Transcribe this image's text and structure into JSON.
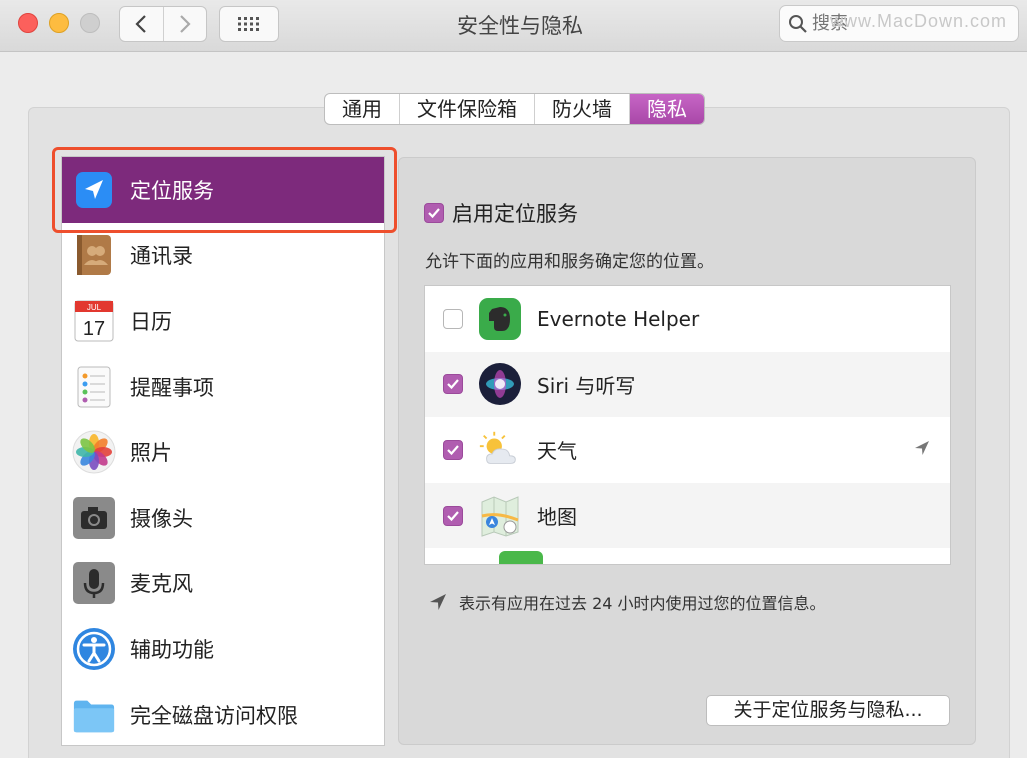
{
  "window": {
    "title": "安全性与隐私",
    "search_placeholder": "搜索",
    "watermark": "www.MacDown.com"
  },
  "tabs": [
    {
      "label": "通用",
      "active": false
    },
    {
      "label": "文件保险箱",
      "active": false
    },
    {
      "label": "防火墙",
      "active": false
    },
    {
      "label": "隐私",
      "active": true
    }
  ],
  "sidebar": {
    "items": [
      {
        "label": "定位服务",
        "icon": "location-arrow-icon",
        "selected": true
      },
      {
        "label": "通讯录",
        "icon": "contacts-icon"
      },
      {
        "label": "日历",
        "icon": "calendar-icon",
        "month": "JUL",
        "day": "17"
      },
      {
        "label": "提醒事项",
        "icon": "reminders-icon"
      },
      {
        "label": "照片",
        "icon": "photos-icon"
      },
      {
        "label": "摄像头",
        "icon": "camera-icon"
      },
      {
        "label": "麦克风",
        "icon": "microphone-icon"
      },
      {
        "label": "辅助功能",
        "icon": "accessibility-icon"
      },
      {
        "label": "完全磁盘访问权限",
        "icon": "folder-icon"
      }
    ]
  },
  "location": {
    "enable_label": "启用定位服务",
    "enabled": true,
    "description": "允许下面的应用和服务确定您的位置。",
    "apps": [
      {
        "name": "Evernote Helper",
        "checked": false,
        "icon": "evernote-icon"
      },
      {
        "name": "Siri 与听写",
        "checked": true,
        "icon": "siri-icon"
      },
      {
        "name": "天气",
        "checked": true,
        "icon": "weather-icon",
        "recent_use": true
      },
      {
        "name": "地图",
        "checked": true,
        "icon": "maps-icon"
      }
    ],
    "footnote": "表示有应用在过去 24 小时内使用过您的位置信息。",
    "about_button": "关于定位服务与隐私..."
  },
  "colors": {
    "accent": "#b05db0",
    "selection": "#7d2a7c",
    "highlight_border": "#ee4f2d"
  }
}
